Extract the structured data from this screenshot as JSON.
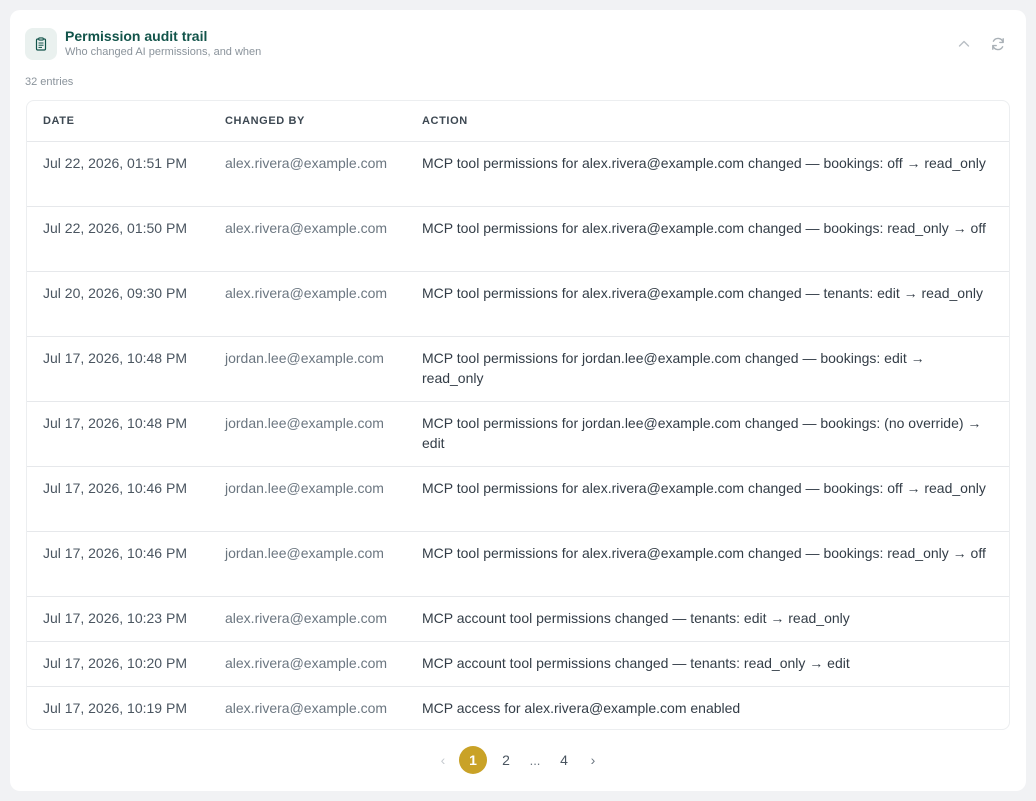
{
  "header": {
    "title": "Permission audit trail",
    "subtitle": "Who changed AI permissions, and when",
    "icon": "clipboard-icon",
    "actions": [
      "chevron-up-icon",
      "refresh-icon"
    ]
  },
  "entry_count": "32 entries",
  "table": {
    "columns": [
      "DATE",
      "CHANGED BY",
      "ACTION"
    ],
    "rows": [
      {
        "date": "Jul 22, 2026, 01:51 PM",
        "by": "alex.rivera@example.com",
        "action": "MCP tool permissions for alex.rivera@example.com changed — bookings: off → read_only"
      },
      {
        "date": "Jul 22, 2026, 01:50 PM",
        "by": "alex.rivera@example.com",
        "action": "MCP tool permissions for alex.rivera@example.com changed — bookings: read_only → off"
      },
      {
        "date": "Jul 20, 2026, 09:30 PM",
        "by": "alex.rivera@example.com",
        "action": "MCP tool permissions for alex.rivera@example.com changed — tenants: edit → read_only"
      },
      {
        "date": "Jul 17, 2026, 10:48 PM",
        "by": "jordan.lee@example.com",
        "action": "MCP tool permissions for jordan.lee@example.com changed — bookings: edit → read_only"
      },
      {
        "date": "Jul 17, 2026, 10:48 PM",
        "by": "jordan.lee@example.com",
        "action": "MCP tool permissions for jordan.lee@example.com changed — bookings: (no override) → edit"
      },
      {
        "date": "Jul 17, 2026, 10:46 PM",
        "by": "jordan.lee@example.com",
        "action": "MCP tool permissions for alex.rivera@example.com changed — bookings: off → read_only"
      },
      {
        "date": "Jul 17, 2026, 10:46 PM",
        "by": "jordan.lee@example.com",
        "action": "MCP tool permissions for alex.rivera@example.com changed — bookings: read_only → off"
      },
      {
        "date": "Jul 17, 2026, 10:23 PM",
        "by": "alex.rivera@example.com",
        "action": "MCP account tool permissions changed — tenants: edit → read_only"
      },
      {
        "date": "Jul 17, 2026, 10:20 PM",
        "by": "alex.rivera@example.com",
        "action": "MCP account tool permissions changed — tenants: read_only → edit"
      },
      {
        "date": "Jul 17, 2026, 10:19 PM",
        "by": "alex.rivera@example.com",
        "action": "MCP access for alex.rivera@example.com enabled"
      }
    ]
  },
  "pagination": {
    "prev": "‹",
    "next": "›",
    "pages": [
      "1",
      "2",
      "4"
    ],
    "ellipsis": "...",
    "current": "1"
  },
  "colors": {
    "accent": "#c9a227",
    "title": "#12544a",
    "icon_bg": "#eaf1ef"
  }
}
